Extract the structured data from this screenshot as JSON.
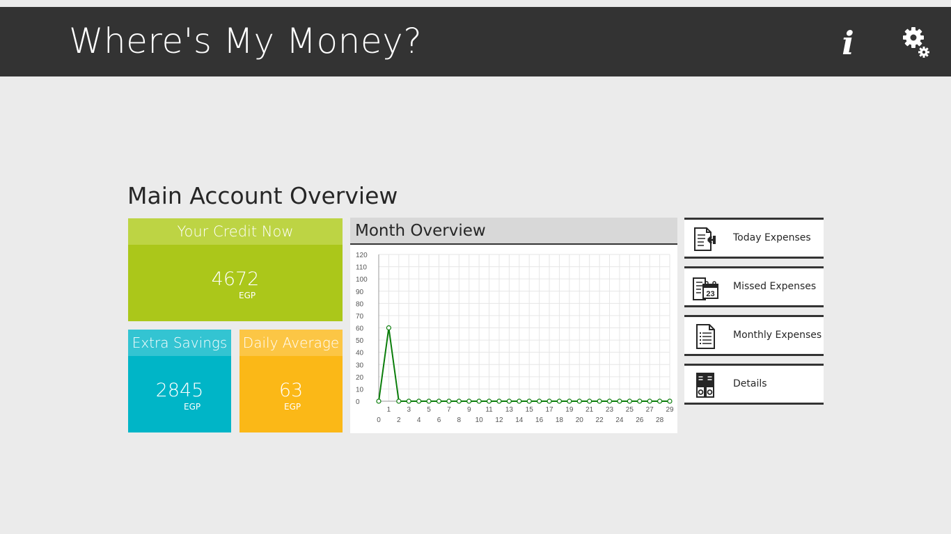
{
  "app": {
    "title": "Where's My Money?",
    "info_icon": "info-icon",
    "info_glyph": "i",
    "settings_icon": "gear-icon"
  },
  "section": {
    "title": "Main Account Overview"
  },
  "tiles": {
    "credit": {
      "title": "Your Credit Now",
      "value": "4672",
      "currency": "EGP",
      "color": "#abc71a",
      "header_color": "#bdd444"
    },
    "savings": {
      "title": "Extra Savings",
      "value": "2845",
      "currency": "EGP",
      "color": "#00b5c7",
      "header_color": "#33c4d2"
    },
    "average": {
      "title": "Daily Average",
      "value": "63",
      "currency": "EGP",
      "color": "#fbb817",
      "header_color": "#fcc645"
    }
  },
  "chart_data": {
    "type": "line",
    "title": "Month Overview",
    "xlabel": "",
    "ylabel": "",
    "x": [
      0,
      1,
      2,
      3,
      4,
      5,
      6,
      7,
      8,
      9,
      10,
      11,
      12,
      13,
      14,
      15,
      16,
      17,
      18,
      19,
      20,
      21,
      22,
      23,
      24,
      25,
      26,
      27,
      28,
      29
    ],
    "series": [
      {
        "values": [
          0,
          60,
          0,
          0,
          0,
          0,
          0,
          0,
          0,
          0,
          0,
          0,
          0,
          0,
          0,
          0,
          0,
          0,
          0,
          0,
          0,
          0,
          0,
          0,
          0,
          0,
          0,
          0,
          0,
          0
        ]
      }
    ],
    "yticks": [
      "0",
      "10",
      "20",
      "30",
      "40",
      "50",
      "60",
      "70",
      "80",
      "90",
      "100",
      "110",
      "120"
    ],
    "xticks_top": [
      "1",
      "3",
      "5",
      "7",
      "9",
      "11",
      "13",
      "15",
      "17",
      "19",
      "21",
      "23",
      "25",
      "27",
      "29"
    ],
    "xticks_bottom": [
      "0",
      "2",
      "4",
      "6",
      "8",
      "10",
      "12",
      "14",
      "16",
      "18",
      "20",
      "22",
      "24",
      "26",
      "28"
    ],
    "ylim": [
      0,
      120
    ],
    "xlim": [
      0,
      29
    ],
    "grid": true,
    "line_color": "#0a7d0a"
  },
  "nav": [
    {
      "label": "Today Expenses",
      "icon": "today-expenses-icon"
    },
    {
      "label": "Missed Expenses",
      "icon": "calendar-icon",
      "icon_text": "23"
    },
    {
      "label": "Monthly Expenses",
      "icon": "document-list-icon"
    },
    {
      "label": "Details",
      "icon": "binders-icon"
    }
  ]
}
